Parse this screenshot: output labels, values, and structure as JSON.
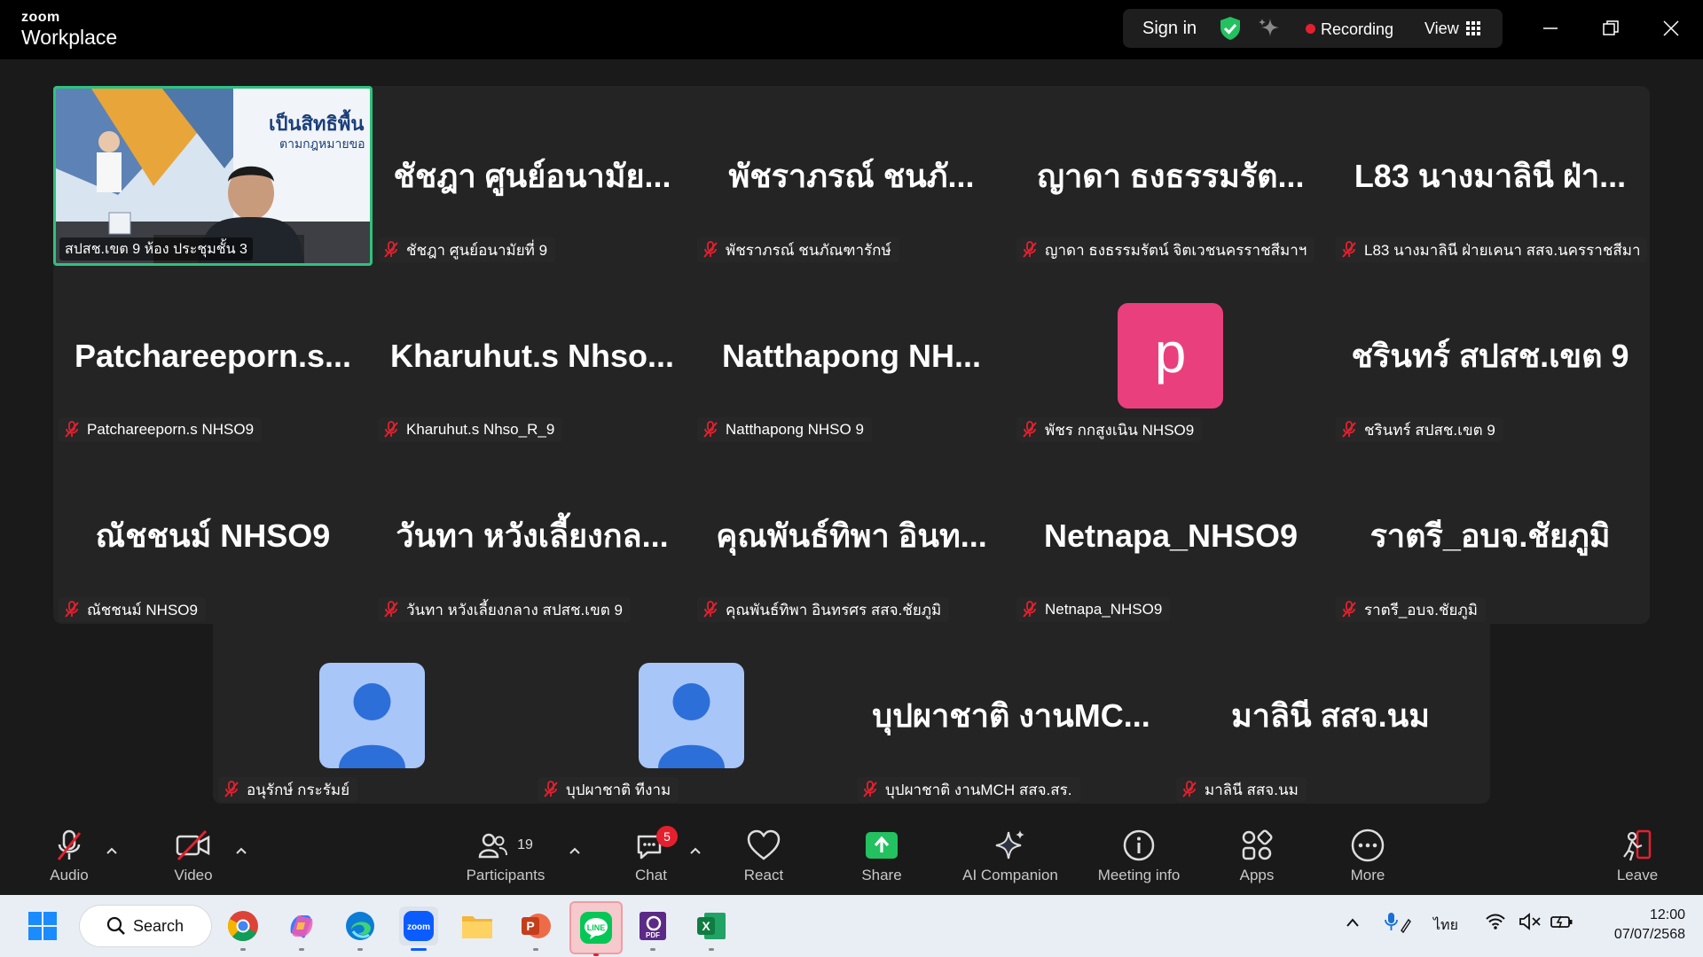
{
  "window": {
    "brand_small": "zoom",
    "brand_large": "Workplace",
    "sign_in": "Sign in",
    "recording": "Recording",
    "view": "View",
    "accent_green": "#2ec27e",
    "record_red": "#e5202e"
  },
  "speaker": {
    "label": "สปสช.เขต 9 ห้อง ประชุมชั้น 3",
    "poster_line1": "เป็นสิทธิพื้น",
    "poster_line2": "ตามกฎหมายขอ"
  },
  "tiles": [
    {
      "big": "ชัชฎา ศูนย์อนามัย...",
      "label": "ชัชฎา ศูนย์อนามัยที่ 9"
    },
    {
      "big": "พัชราภรณ์ ชนภั...",
      "label": "พัชราภรณ์ ชนภัณฑารักษ์"
    },
    {
      "big": "ญาดา ธงธรรมรัต...",
      "label": "ญาดา ธงธรรมรัตน์ จิตเวชนครราชสีมาฯ"
    },
    {
      "big": "L83 นางมาลินี ฝ่า...",
      "label": "L83 นางมาลินี ฝ่ายเคนา สสจ.นครราชสีมา"
    },
    {
      "big": "Patchareeporn.s...",
      "label": "Patchareeporn.s NHSO9"
    },
    {
      "big": "Kharuhut.s Nhso...",
      "label": "Kharuhut.s Nhso_R_9"
    },
    {
      "big": "Natthapong NH...",
      "label": "Natthapong NHSO 9"
    },
    {
      "big": "",
      "avatar_letter": "p",
      "label": "พัชร กกสูงเนิน NHSO9"
    },
    {
      "big": "ชรินทร์ สปสช.เขต 9",
      "label": "ชรินทร์ สปสช.เขต 9"
    },
    {
      "big": "ณัชชนม์ NHSO9",
      "label": "ณัชชนม์ NHSO9"
    },
    {
      "big": "วันทา หวังเลี้ยงกล...",
      "label": "วันทา หวังเลี้ยงกลาง สปสช.เขต 9"
    },
    {
      "big": "คุณพันธ์ทิพา อินท...",
      "label": "คุณพันธ์ทิพา อินทรศร สสจ.ชัยภูมิ"
    },
    {
      "big": "Netnapa_NHSO9",
      "label": "Netnapa_NHSO9"
    },
    {
      "big": "ราตรี_อบจ.ชัยภูมิ",
      "label": "ราตรี_อบจ.ชัยภูมิ"
    },
    {
      "big": "",
      "avatar": "person",
      "label": "อนุรักษ์ กระรัมย์"
    },
    {
      "big": "",
      "avatar": "person",
      "label": "บุปผาชาติ ทีงาม"
    },
    {
      "big": "บุปผาชาติ งานMC...",
      "label": "บุปผาชาติ งานMCH สสจ.สร."
    },
    {
      "big": "มาลินี สสจ.นม",
      "label": "มาลินี สสจ.นม"
    }
  ],
  "toolbar": {
    "audio": "Audio",
    "video": "Video",
    "participants": "Participants",
    "participants_count": "19",
    "chat": "Chat",
    "chat_badge": "5",
    "react": "React",
    "share": "Share",
    "ai": "AI Companion",
    "info": "Meeting info",
    "apps": "Apps",
    "more": "More",
    "leave": "Leave"
  },
  "taskbar": {
    "search": "Search",
    "lang": "ไทย",
    "time": "12:00",
    "date": "07/07/2568"
  }
}
